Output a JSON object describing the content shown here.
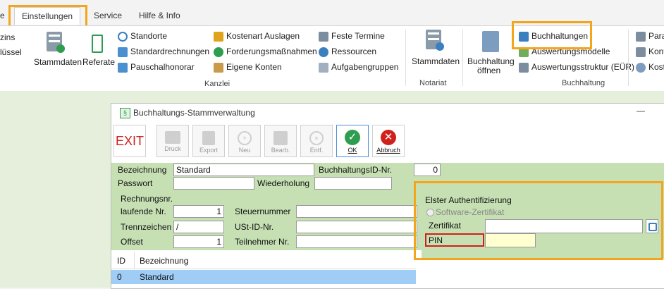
{
  "tabs": {
    "partial": "e",
    "active": "Einstellungen",
    "service": "Service",
    "help": "Hilfe & Info"
  },
  "ribbon": {
    "left_partial1": "zins",
    "left_partial2": "lüssel",
    "stammdaten": "Stammdaten",
    "referate": "Referate",
    "standorte": "Standorte",
    "standardrechnungen": "Standardrechnungen",
    "pauschalhonorar": "Pauschalhonorar",
    "kostenart": "Kostenart Auslagen",
    "forderung": "Forderungsmaßnahmen",
    "eigene_konten": "Eigene Konten",
    "feste_termine": "Feste Termine",
    "ressourcen": "Ressourcen",
    "aufgabengruppen": "Aufgabengruppen",
    "notariat_stammdaten": "Stammdaten",
    "buchhaltung_oeffnen_1": "Buchhaltung",
    "buchhaltung_oeffnen_2": "öffnen",
    "buchhaltungen": "Buchhaltungen",
    "auswertungsmodelle": "Auswertungsmodelle",
    "auswertungsstruktur": "Auswertungsstruktur (EÜR)",
    "right1": "Para",
    "right2": "Kont",
    "right3": "Kost",
    "group_kanzlei": "Kanzlei",
    "group_notariat": "Notariat",
    "group_buchhaltung": "Buchhaltung"
  },
  "dialog": {
    "title": "Buchhaltungs-Stammverwaltung",
    "close": "—",
    "toolbar": {
      "exit": "EXIT",
      "druck": "Druck",
      "export": "Export",
      "neu": "Neu",
      "bearb": "Bearb.",
      "entf": "Entf.",
      "ok": "OK",
      "abbruch": "Abbruch"
    },
    "form": {
      "bezeichnung_label": "Bezeichnung",
      "bezeichnung_value": "Standard",
      "id_label": "BuchhaltungsID-Nr.",
      "id_value": "0",
      "passwort_label": "Passwort",
      "passwort_value": "",
      "wiederholung_label": "Wiederholung",
      "wiederholung_value": "",
      "rechnungsnr_label": "Rechnungsnr.",
      "laufende_label": "laufende Nr.",
      "laufende_value": "1",
      "trennzeichen_label": "Trennzeichen",
      "trennzeichen_value": "/",
      "offset_label": "Offset",
      "offset_value": "1",
      "steuernummer_label": "Steuernummer",
      "steuernummer_value": "",
      "ustid_label": "USt-ID-Nr.",
      "ustid_value": "",
      "teilnehmer_label": "Teilnehmer Nr.",
      "teilnehmer_value": ""
    },
    "elster": {
      "title": "Elster Authentifizierung",
      "radio": "Software-Zertifikat",
      "zertifikat_label": "Zertifikat",
      "zertifikat_value": "",
      "pin_label": "PIN",
      "pin_value": ""
    },
    "table": {
      "headers": [
        "ID",
        "Bezeichnung"
      ],
      "rows": [
        [
          "0",
          "Standard"
        ]
      ]
    }
  }
}
